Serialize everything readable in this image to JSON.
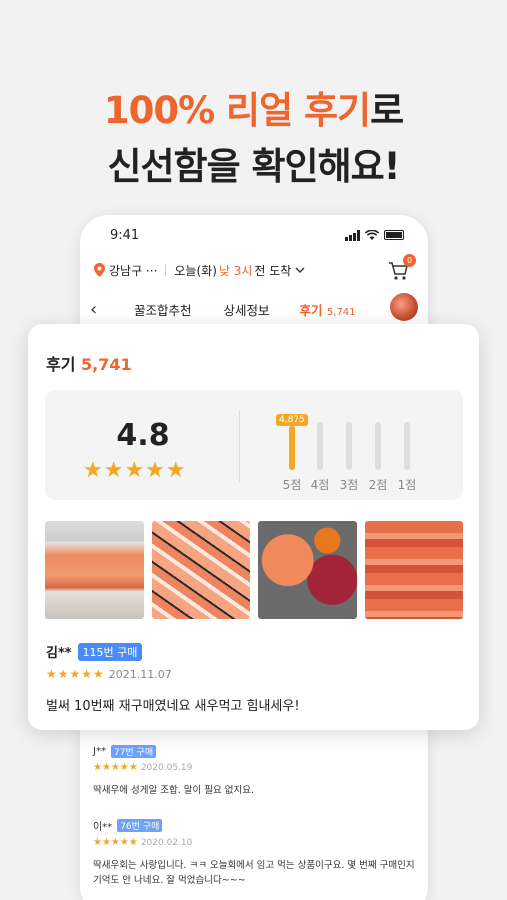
{
  "headline": {
    "line1_highlight": "100% 리얼 후기",
    "line1_rest": "로",
    "line2": "신선함을 확인해요!"
  },
  "status": {
    "time": "9:41"
  },
  "location": {
    "area": "강남구 ···",
    "delivery_day": "오늘(화)",
    "delivery_time": "낮 3시",
    "delivery_suffix": "전 도착",
    "cart_count": "0"
  },
  "tabs": {
    "items": [
      {
        "label": "꿀조합추천"
      },
      {
        "label": "상세정보"
      }
    ],
    "active_label": "후기",
    "active_count": "5,741"
  },
  "review_card": {
    "title": "후기",
    "count": "5,741",
    "rating": "4.8",
    "stars": "★★★★★",
    "distribution": [
      {
        "label": "5점",
        "fraction": 0.92,
        "bubble": "4,875"
      },
      {
        "label": "4점",
        "fraction": 0.0
      },
      {
        "label": "3점",
        "fraction": 0.0
      },
      {
        "label": "2점",
        "fraction": 0.0
      },
      {
        "label": "1점",
        "fraction": 0.0
      }
    ],
    "top_review": {
      "name": "김**",
      "badge": "115번 구매",
      "stars": "★★★★★",
      "date": "2021.11.07",
      "text": "벌써 10번째 재구매였네요 새우먹고 힘내세우!"
    }
  },
  "more_reviews": [
    {
      "name": "J**",
      "badge": "77번 구매",
      "stars": "★★★★★",
      "date": "2020.05.19",
      "text": "딱새우에 성게알 조합. 말이 필요 없지요."
    },
    {
      "name": "이**",
      "badge": "76번 구매",
      "stars": "★★★★★",
      "date": "2020.02.10",
      "text": "딱새우회는 사랑입니다. ㅋㅋ 오늘회에서 임고 먹는 상품이구요. 몇 번째 구매인지",
      "text2": "기억도 안 나네요. 잘 먹었습니다~~~"
    }
  ]
}
